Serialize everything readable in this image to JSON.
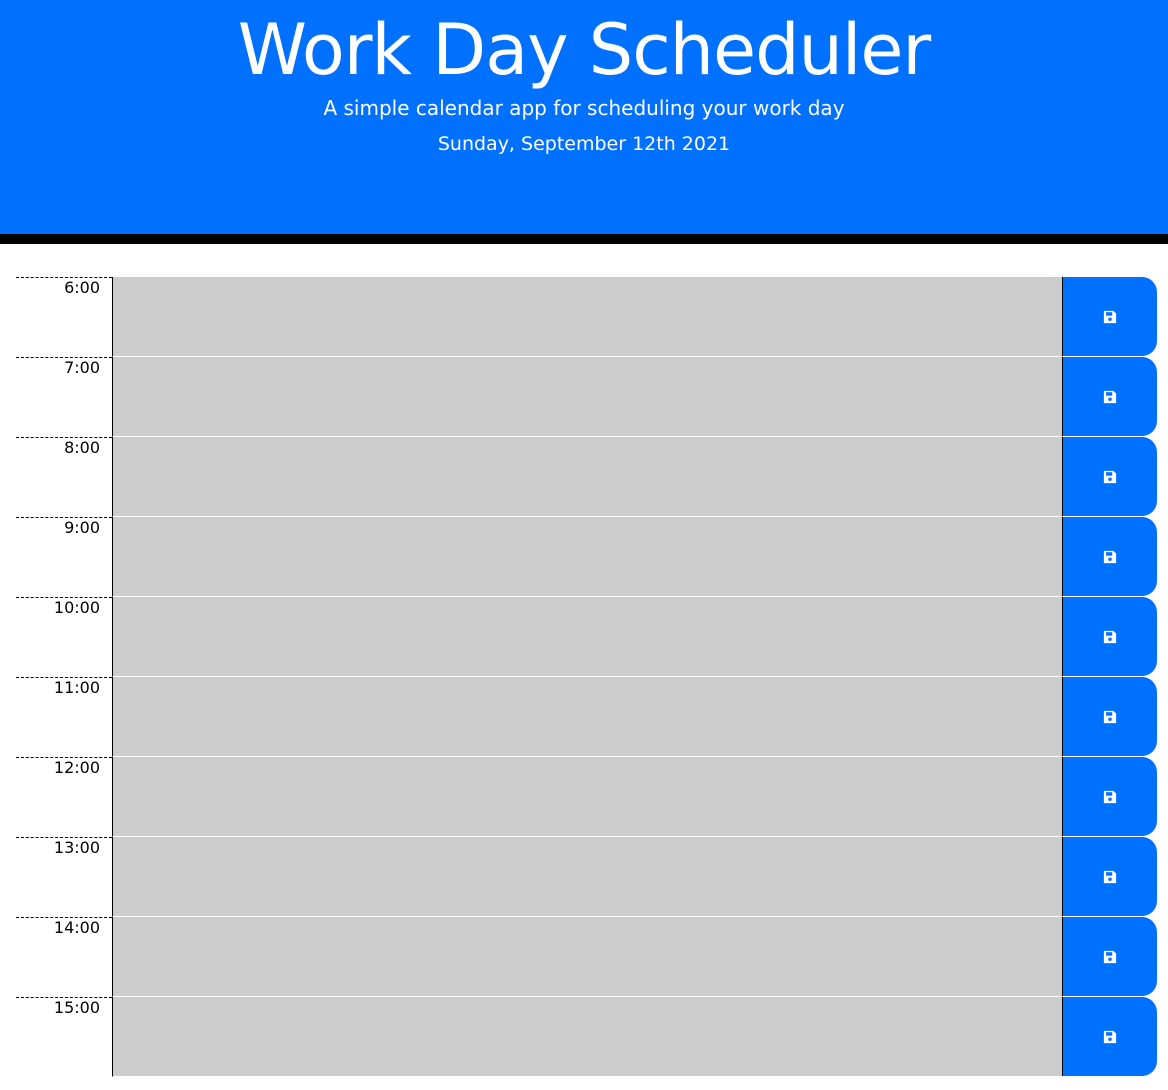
{
  "header": {
    "title": "Work Day Scheduler",
    "subtitle": "A simple calendar app for scheduling your work day",
    "current_date": "Sunday, September 12th 2021"
  },
  "schedule": {
    "rows": [
      {
        "hour": "6:00",
        "description": "",
        "save_icon": "save-icon"
      },
      {
        "hour": "7:00",
        "description": "",
        "save_icon": "save-icon"
      },
      {
        "hour": "8:00",
        "description": "",
        "save_icon": "save-icon"
      },
      {
        "hour": "9:00",
        "description": "",
        "save_icon": "save-icon"
      },
      {
        "hour": "10:00",
        "description": "",
        "save_icon": "save-icon"
      },
      {
        "hour": "11:00",
        "description": "",
        "save_icon": "save-icon"
      },
      {
        "hour": "12:00",
        "description": "",
        "save_icon": "save-icon"
      },
      {
        "hour": "13:00",
        "description": "",
        "save_icon": "save-icon"
      },
      {
        "hour": "14:00",
        "description": "",
        "save_icon": "save-icon"
      },
      {
        "hour": "15:00",
        "description": "",
        "save_icon": "save-icon"
      }
    ]
  },
  "colors": {
    "header_background": "#0070ff",
    "header_border": "#000000",
    "time_block_past": "#cccccc",
    "save_button": "#0070ff",
    "save_icon": "#ffffff"
  }
}
